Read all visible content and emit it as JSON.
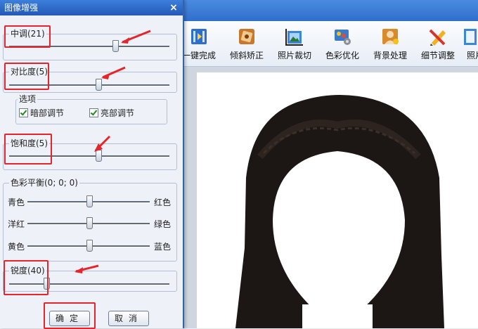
{
  "dialog": {
    "title": "图像增强",
    "close_glyph": "×",
    "midtone": {
      "label": "中调(21)",
      "value": 21
    },
    "contrast": {
      "label": "对比度(5)",
      "value": 5
    },
    "options": {
      "label": "选项",
      "dark_adjust": "暗部调节",
      "bright_adjust": "亮部调节"
    },
    "saturation": {
      "label": "饱和度(5)",
      "value": 5
    },
    "color_balance": {
      "label": "色彩平衡(0; 0; 0)",
      "rows": [
        {
          "left": "青色",
          "right": "红色"
        },
        {
          "left": "洋红",
          "right": "绿色"
        },
        {
          "left": "黄色",
          "right": "蓝色"
        }
      ]
    },
    "sharpness": {
      "label": "锐度(40)",
      "value": 40
    },
    "ok_label": "确定",
    "cancel_label": "取消"
  },
  "toolbar": {
    "items": [
      {
        "label": "一键完成",
        "icon": "film-icon"
      },
      {
        "label": "倾斜矫正",
        "icon": "rotate-icon"
      },
      {
        "label": "照片裁切",
        "icon": "crop-icon"
      },
      {
        "label": "色彩优化",
        "icon": "palette-icon"
      },
      {
        "label": "背景处理",
        "icon": "person-icon"
      },
      {
        "label": "细节调整",
        "icon": "pencil-icon"
      },
      {
        "label": "照片",
        "icon": "page-icon"
      }
    ]
  },
  "colors": {
    "highlight_red": "#e4252b",
    "dialog_title_blue": "#2f6fcc",
    "hair": "#1c1714"
  }
}
